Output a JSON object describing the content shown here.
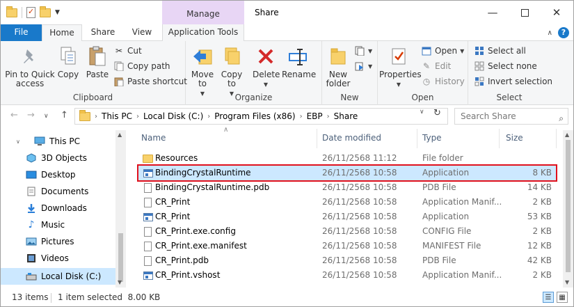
{
  "window": {
    "title": "Share",
    "context_tab_header": "Manage",
    "colors": {
      "file_tab": "#1979ca",
      "manage_tab": "#e8d6f5",
      "selection": "#cce8ff",
      "highlight_border": "#e0101c"
    }
  },
  "tabs": {
    "file": "File",
    "home": "Home",
    "share": "Share",
    "view": "View",
    "application_tools": "Application Tools"
  },
  "ribbon": {
    "clipboard": {
      "label": "Clipboard",
      "pin": "Pin to Quick access",
      "copy": "Copy",
      "paste": "Paste",
      "cut": "Cut",
      "copy_path": "Copy path",
      "paste_shortcut": "Paste shortcut"
    },
    "organize": {
      "label": "Organize",
      "move_to": "Move to",
      "copy_to": "Copy to",
      "delete": "Delete",
      "rename": "Rename"
    },
    "new": {
      "label": "New",
      "new_folder": "New folder"
    },
    "open": {
      "label": "Open",
      "properties": "Properties",
      "open": "Open",
      "edit": "Edit",
      "history": "History"
    },
    "select": {
      "label": "Select",
      "select_all": "Select all",
      "select_none": "Select none",
      "invert_selection": "Invert selection"
    }
  },
  "address": {
    "breadcrumbs": [
      "This PC",
      "Local Disk (C:)",
      "Program Files (x86)",
      "EBP",
      "Share"
    ],
    "search_placeholder": "Search Share"
  },
  "nav": {
    "items": [
      {
        "label": "This PC",
        "icon": "computer-icon"
      },
      {
        "label": "3D Objects",
        "icon": "cube-icon"
      },
      {
        "label": "Desktop",
        "icon": "desktop-icon"
      },
      {
        "label": "Documents",
        "icon": "documents-icon"
      },
      {
        "label": "Downloads",
        "icon": "download-icon"
      },
      {
        "label": "Music",
        "icon": "music-icon"
      },
      {
        "label": "Pictures",
        "icon": "pictures-icon"
      },
      {
        "label": "Videos",
        "icon": "videos-icon"
      },
      {
        "label": "Local Disk (C:)",
        "icon": "drive-icon"
      }
    ]
  },
  "columns": {
    "name": "Name",
    "date": "Date modified",
    "type": "Type",
    "size": "Size"
  },
  "files": [
    {
      "name": "Resources",
      "date": "26/11/2568 11:12",
      "type": "File folder",
      "size": "",
      "icon": "folder"
    },
    {
      "name": "BindingCrystalRuntime",
      "date": "26/11/2568 10:58",
      "type": "Application",
      "size": "8 KB",
      "icon": "app"
    },
    {
      "name": "BindingCrystalRuntime.pdb",
      "date": "26/11/2568 10:58",
      "type": "PDB File",
      "size": "14 KB",
      "icon": "doc"
    },
    {
      "name": "CR_Print",
      "date": "26/11/2568 10:58",
      "type": "Application Manif...",
      "size": "2 KB",
      "icon": "doc"
    },
    {
      "name": "CR_Print",
      "date": "26/11/2568 10:58",
      "type": "Application",
      "size": "53 KB",
      "icon": "app"
    },
    {
      "name": "CR_Print.exe.config",
      "date": "26/11/2568 10:58",
      "type": "CONFIG File",
      "size": "2 KB",
      "icon": "doc"
    },
    {
      "name": "CR_Print.exe.manifest",
      "date": "26/11/2568 10:58",
      "type": "MANIFEST File",
      "size": "12 KB",
      "icon": "doc"
    },
    {
      "name": "CR_Print.pdb",
      "date": "26/11/2568 10:58",
      "type": "PDB File",
      "size": "42 KB",
      "icon": "doc"
    },
    {
      "name": "CR_Print.vshost",
      "date": "26/11/2568 10:58",
      "type": "Application Manif...",
      "size": "2 KB",
      "icon": "app"
    }
  ],
  "status": {
    "items": "13 items",
    "selected": "1 item selected  8.00 KB"
  }
}
